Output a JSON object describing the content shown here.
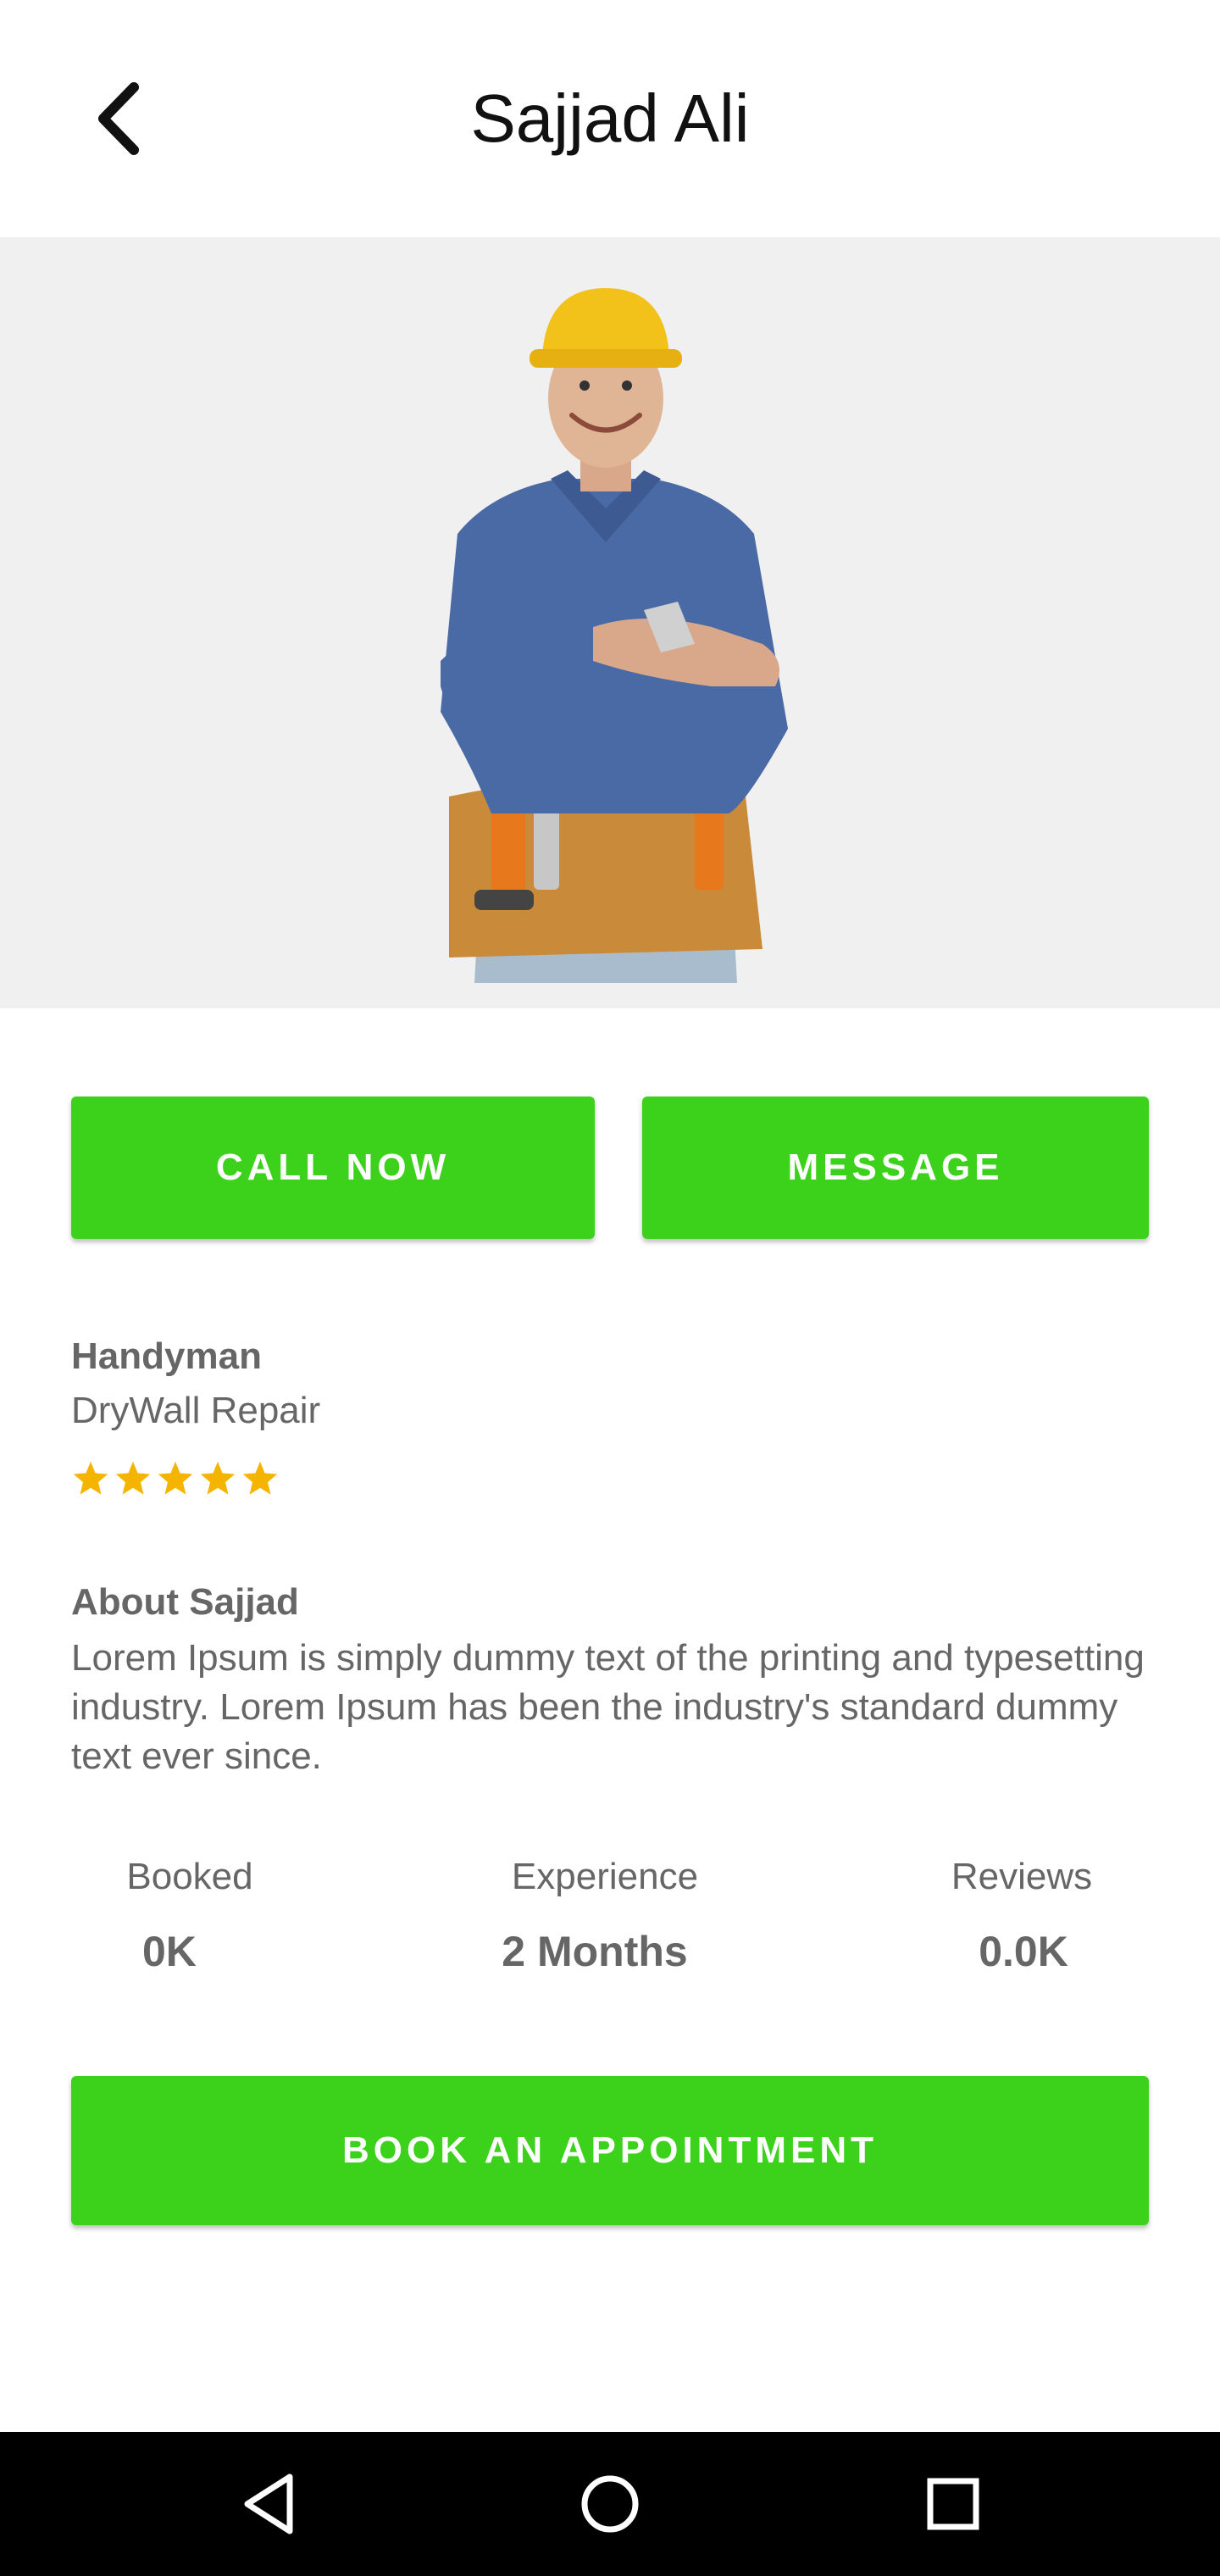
{
  "header": {
    "title": "Sajjad Ali",
    "back_icon": "chevron-left-icon"
  },
  "hero": {
    "image": "handyman-photo",
    "background": "#f0f0f0"
  },
  "actions": {
    "call_label": "CALL NOW",
    "message_label": "MESSAGE",
    "book_label": "BOOK AN APPOINTMENT",
    "accent_color": "#3cd11b"
  },
  "profile": {
    "category": "Handyman",
    "service": "DryWall Repair",
    "rating": 5,
    "rating_max": 5,
    "star_color": "#f5b400"
  },
  "about": {
    "title": "About Sajjad",
    "text": "Lorem Ipsum is simply dummy text of the printing and typesetting industry. Lorem Ipsum has been the industry's standard dummy text ever since."
  },
  "stats": {
    "booked_label": "Booked",
    "booked_value": "0K",
    "experience_label": "Experience",
    "experience_value": "2 Months",
    "reviews_label": "Reviews",
    "reviews_value": "0.0K"
  },
  "navbar": {
    "back_icon": "triangle-back-icon",
    "home_icon": "circle-home-icon",
    "recent_icon": "square-recents-icon"
  }
}
